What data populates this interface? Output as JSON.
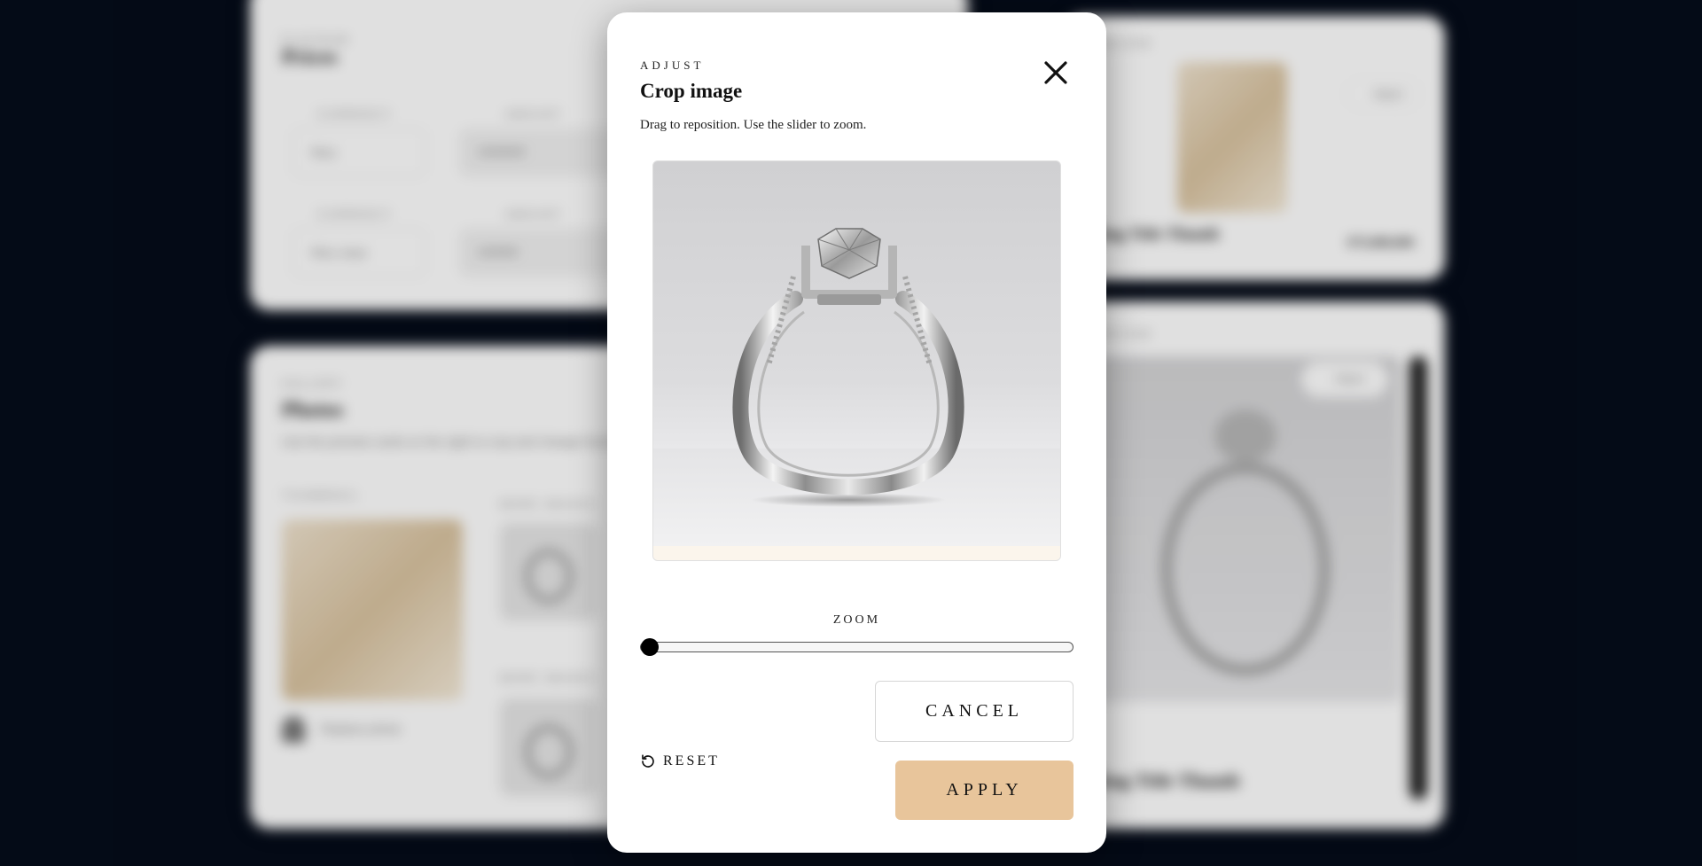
{
  "background": {
    "pricing_card": {
      "eyebrow": "PLATINUM",
      "title": "Prices",
      "rows": [
        {
          "label_a": "CURRENCY",
          "select": "Rtnz",
          "label_b": "AMOUNT",
          "input": "1500000"
        },
        {
          "label_a": "CURRENCY",
          "select": "Rtnz clear",
          "label_b": "AMOUNT",
          "input": "150000"
        }
      ]
    },
    "photos_card": {
      "eyebrow": "GALLERY",
      "title": "Photos",
      "desc": "Use the preview cards on the right to crop and change focal points.",
      "thumb_label": "THUMBNAIL",
      "side_label_1": "MORE IMAGES",
      "side_label_2": "MORE IMAGES",
      "avatar_caption": "Replace photo"
    },
    "preview_card_top": {
      "eyebrow": "PREVIEW",
      "button": "Adjust",
      "product_name": "Ring Title Thumb",
      "price": "$75,000,000"
    },
    "preview_card_bottom": {
      "eyebrow": "PREVIEW",
      "button": "Adjust",
      "product_name": "Ring Title Thumb"
    }
  },
  "modal": {
    "eyebrow": "ADJUST",
    "title": "Crop image",
    "description": "Drag to reposition. Use the slider to zoom.",
    "close_icon": "close-icon",
    "zoom_label": "ZOOM",
    "zoom_value": 0,
    "reset_label": "RESET",
    "reset_icon": "rotate-ccw-icon",
    "cancel_label": "CANCEL",
    "apply_label": "APPLY",
    "colors": {
      "apply_bg": "#e8c59b",
      "backdrop": "#050c1a"
    }
  }
}
